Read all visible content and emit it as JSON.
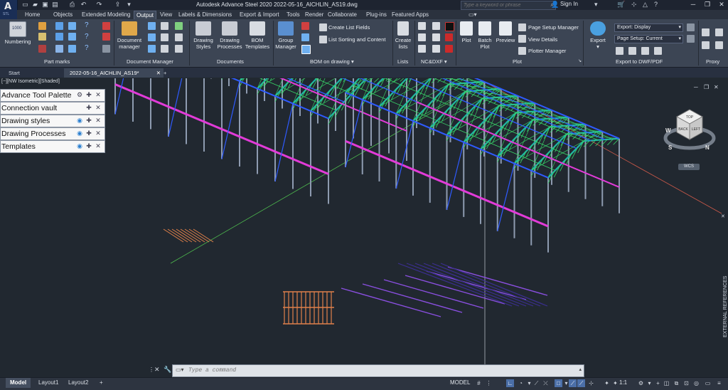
{
  "app": {
    "logo_letter": "A",
    "logo_sub": "STL",
    "window_title": "Autodesk Advance Steel 2020    2022-05-16_AICHLIN_AS19.dwg",
    "search_placeholder": "Type a keyword or phrase",
    "sign_in": "Sign In",
    "help": "?"
  },
  "menu_tabs": [
    "Home",
    "Objects",
    "Extended Modeling",
    "Output",
    "View",
    "Labels & Dimensions",
    "Export & Import",
    "Tools",
    "Render",
    "Collaborate",
    "Plug-ins",
    "Featured Apps"
  ],
  "active_tab": "Output",
  "ribbon": {
    "numbering": "Numbering",
    "panel_part_marks": "Part marks",
    "document_manager": "Document manager",
    "panel_document_manager": "Document Manager",
    "drawing_styles": "Drawing Styles",
    "drawing_processes": "Drawing Processes",
    "bom_templates": "BOM Templates",
    "panel_documents": "Documents",
    "group_manager": "Group Manager",
    "create_list_fields": "Create List Fields",
    "list_sorting": "List Sorting and Content",
    "panel_bom": "BOM on drawing",
    "create_lists": "Create lists",
    "panel_lists": "Lists",
    "panel_ncdxf": "NC&DXF",
    "plot": "Plot",
    "batch_plot": "Batch Plot",
    "preview": "Preview",
    "page_setup_manager": "Page Setup Manager",
    "view_details": "View Details",
    "plotter_manager": "Plotter Manager",
    "panel_plot": "Plot",
    "export": "Export",
    "export_display": "Export: Display",
    "page_setup_current": "Page Setup: Current",
    "panel_export": "Export to DWF/PDF",
    "panel_proxy": "Proxy"
  },
  "doc_tabs": {
    "start": "Start",
    "file": "2022-05-16_AICHLIN_AS19*",
    "add": "+"
  },
  "viewport": {
    "label": "[−][NW Isometric][Shaded]",
    "viewcube_top": "TOP",
    "viewcube_left": "LEFT",
    "viewcube_back": "BACK",
    "compass_n": "N",
    "compass_w": "W",
    "compass_s": "S",
    "wcs": "WCS",
    "external_references": "EXTERNAL REFERENCES"
  },
  "palettes": [
    "Advance Tool Palette",
    "Connection vault",
    "Drawing styles",
    "Drawing Processes",
    "Templates"
  ],
  "command_placeholder": "Type a command",
  "layout_tabs": [
    "Model",
    "Layout1",
    "Layout2"
  ],
  "layout_add": "+",
  "status": {
    "model": "MODEL",
    "scale": "1:1"
  },
  "colors": {
    "frame_green": "#39d96a",
    "beam_blue": "#2f5bff",
    "beam_magenta": "#e23bd8",
    "teal": "#1fb5a5",
    "orange": "#e0804a"
  }
}
